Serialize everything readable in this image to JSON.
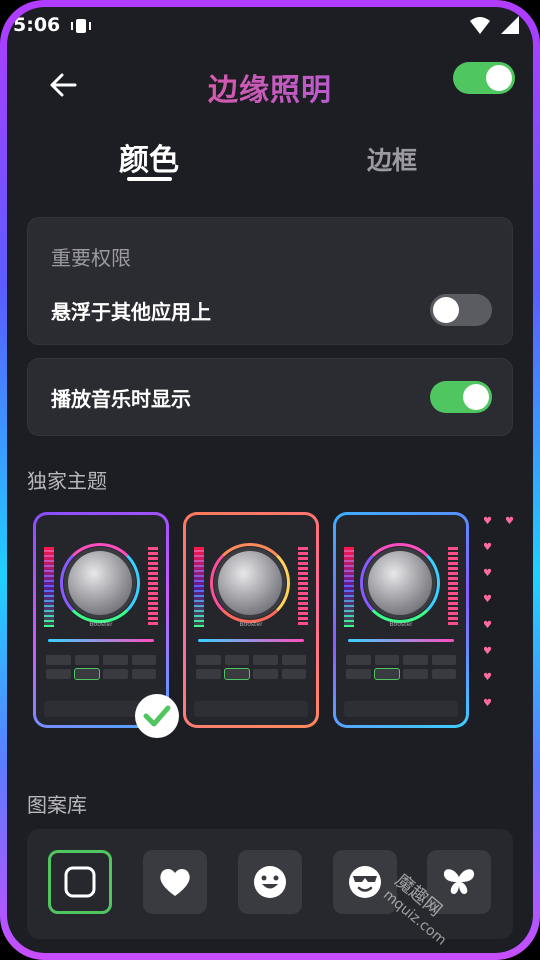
{
  "status_bar": {
    "time": "5:06"
  },
  "header": {
    "title": "边缘照明",
    "master_toggle": true
  },
  "tabs": [
    {
      "label": "颜色",
      "active": true
    },
    {
      "label": "边框",
      "active": false
    }
  ],
  "permissions": {
    "subtitle": "重要权限",
    "overlay_label": "悬浮于其他应用上",
    "overlay_enabled": false
  },
  "music": {
    "label": "播放音乐时显示",
    "enabled": true
  },
  "themes": {
    "title": "独家主题",
    "mini_label": "Booster",
    "items": [
      {
        "name": "theme-purple-blue",
        "selected": true
      },
      {
        "name": "theme-orange-pink",
        "selected": false
      },
      {
        "name": "theme-blue-purple",
        "selected": false
      },
      {
        "name": "theme-hearts",
        "selected": false
      }
    ]
  },
  "patterns": {
    "title": "图案库",
    "items": [
      {
        "icon": "rounded-square-icon",
        "selected": true
      },
      {
        "icon": "heart-icon",
        "selected": false
      },
      {
        "icon": "smiley-icon",
        "selected": false
      },
      {
        "icon": "cool-face-icon",
        "selected": false
      },
      {
        "icon": "butterfly-icon",
        "selected": false
      }
    ]
  },
  "watermark": {
    "text": "魔趣网",
    "subtext": "mquiz.com"
  },
  "colors": {
    "accent_green": "#4fc65f",
    "title_gradient_start": "#ff5a7a",
    "title_gradient_end": "#8f5bff"
  }
}
